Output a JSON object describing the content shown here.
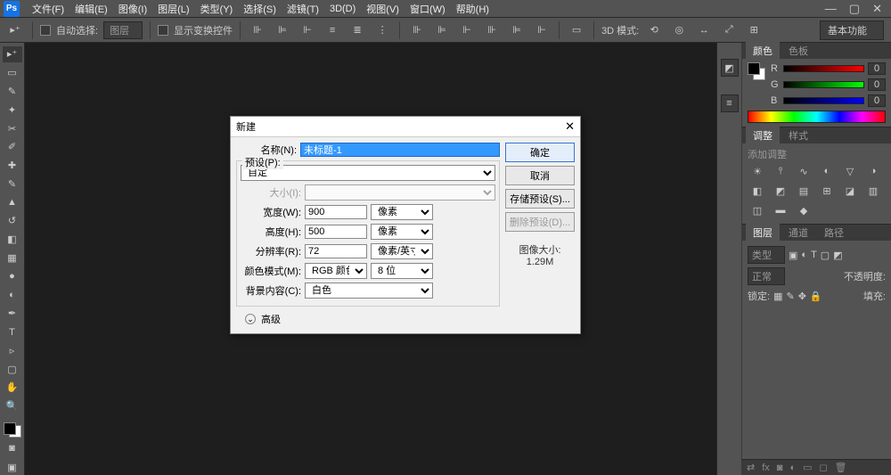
{
  "app": {
    "logo": "Ps"
  },
  "menu": {
    "file": "文件(F)",
    "edit": "编辑(E)",
    "image": "图像(I)",
    "layer": "图层(L)",
    "type": "类型(Y)",
    "select": "选择(S)",
    "filter": "滤镜(T)",
    "threeD": "3D(D)",
    "view": "视图(V)",
    "window": "窗口(W)",
    "help": "帮助(H)"
  },
  "options": {
    "auto_select": "自动选择:",
    "auto_select_value": "图层",
    "show_transform": "显示变换控件",
    "mode3d": "3D 模式:",
    "workspace": "基本功能"
  },
  "panels": {
    "color_tab": "颜色",
    "swatches_tab": "色板",
    "color": {
      "r": "R",
      "g": "G",
      "b": "B",
      "val": "0"
    },
    "adjust_tab": "调整",
    "styles_tab": "样式",
    "adjust_hint": "添加调整",
    "layers_tab": "图层",
    "channels_tab": "通道",
    "paths_tab": "路径",
    "layers": {
      "kind": "类型",
      "normal": "正常",
      "opacity_lbl": "不透明度:",
      "lock_lbl": "锁定:",
      "fill_lbl": "填充:"
    }
  },
  "dialog": {
    "title": "新建",
    "name_lbl": "名称(N):",
    "name_val": "未标题-1",
    "preset_lbl": "预设(P):",
    "preset_val": "自定",
    "size_lbl": "大小(I):",
    "width_lbl": "宽度(W):",
    "width_val": "900",
    "width_unit": "像素",
    "height_lbl": "高度(H):",
    "height_val": "500",
    "height_unit": "像素",
    "res_lbl": "分辨率(R):",
    "res_val": "72",
    "res_unit": "像素/英寸",
    "mode_lbl": "颜色模式(M):",
    "mode_val": "RGB 颜色",
    "depth_val": "8 位",
    "bg_lbl": "背景内容(C):",
    "bg_val": "白色",
    "advanced": "高级",
    "imgsize_lbl": "图像大小:",
    "imgsize_val": "1.29M",
    "ok": "确定",
    "cancel": "取消",
    "save_preset": "存储预设(S)...",
    "delete_preset": "删除预设(D)..."
  }
}
